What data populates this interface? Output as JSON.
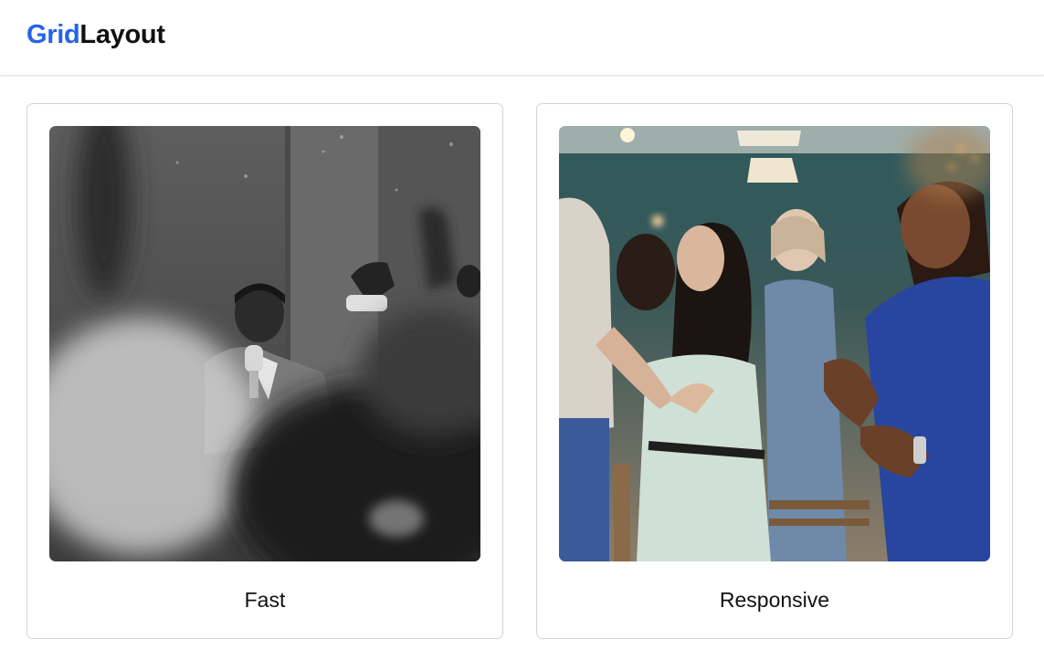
{
  "brand": {
    "accent": "Grid",
    "rest": "Layout",
    "accent_color": "#2563eb"
  },
  "cards": [
    {
      "caption": "Fast",
      "image": "black-and-white photo of a man singing into a microphone with raised hands around"
    },
    {
      "caption": "Responsive",
      "image": "color photo of women clapping and singing in a bright room"
    }
  ]
}
